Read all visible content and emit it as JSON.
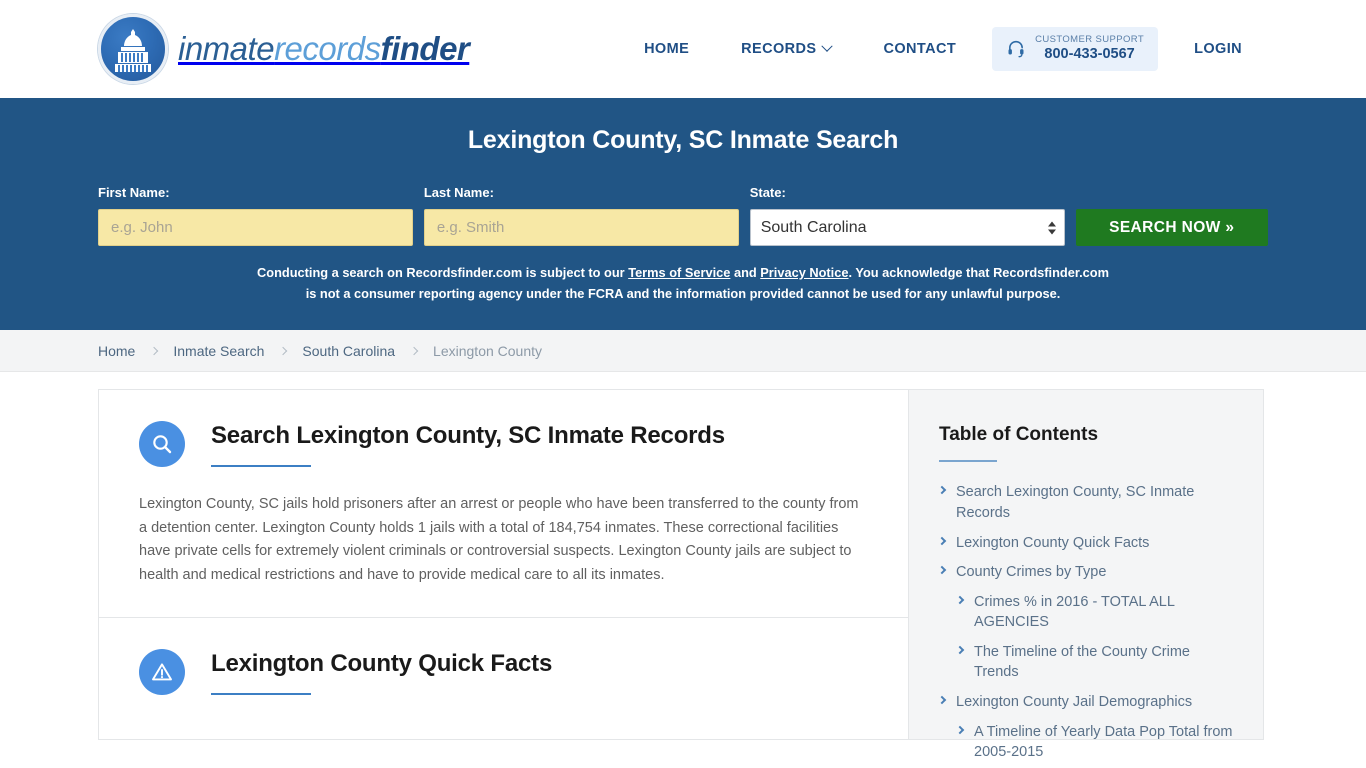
{
  "header": {
    "logo": {
      "icon": "capitol-dome-icon",
      "part1": "inmate",
      "part2": "records",
      "part3": "finder"
    },
    "nav": [
      {
        "label": "HOME",
        "has_caret": false
      },
      {
        "label": "RECORDS",
        "has_caret": true
      },
      {
        "label": "CONTACT",
        "has_caret": false
      }
    ],
    "support": {
      "icon": "headset-icon",
      "label": "CUSTOMER SUPPORT",
      "phone": "800-433-0567"
    },
    "login_label": "LOGIN"
  },
  "hero": {
    "title": "Lexington County, SC Inmate Search",
    "first_name": {
      "label": "First Name:",
      "value": "",
      "placeholder": "e.g. John"
    },
    "last_name": {
      "label": "Last Name:",
      "value": "",
      "placeholder": "e.g. Smith"
    },
    "state": {
      "label": "State:",
      "value": "South Carolina"
    },
    "search_button": "SEARCH NOW »",
    "disclaimer": {
      "part1": "Conducting a search on Recordsfinder.com is subject to our ",
      "link1": "Terms of Service",
      "part2": " and ",
      "link2": "Privacy Notice",
      "part3": ". You acknowledge that Recordsfinder.com is not a consumer reporting agency under the FCRA and the information provided cannot be used for any unlawful purpose."
    },
    "bg_color": "#215585",
    "button_color": "#1f7a20",
    "input_color": "#f7e8a6"
  },
  "breadcrumb": [
    {
      "label": "Home",
      "current": false
    },
    {
      "label": "Inmate Search",
      "current": false
    },
    {
      "label": "South Carolina",
      "current": false
    },
    {
      "label": "Lexington County",
      "current": true
    }
  ],
  "main": {
    "sections": [
      {
        "icon": "magnifier-icon",
        "title": "Search Lexington County, SC Inmate Records",
        "text": "Lexington County, SC jails hold prisoners after an arrest or people who have been transferred to the county from a detention center. Lexington County holds 1 jails with a total of 184,754 inmates. These correctional facilities have private cells for extremely violent criminals or controversial suspects. Lexington County jails are subject to health and medical restrictions and have to provide medical care to all its inmates."
      },
      {
        "icon": "warning-icon",
        "title": "Lexington County Quick Facts",
        "text": ""
      }
    ]
  },
  "sidebar": {
    "title": "Table of Contents",
    "items": [
      {
        "label": "Search Lexington County, SC Inmate Records",
        "level": 1
      },
      {
        "label": "Lexington County Quick Facts",
        "level": 1
      },
      {
        "label": "County Crimes by Type",
        "level": 1
      },
      {
        "label": "Crimes % in 2016 - TOTAL ALL AGENCIES",
        "level": 2
      },
      {
        "label": "The Timeline of the County Crime Trends",
        "level": 2
      },
      {
        "label": "Lexington County Jail Demographics",
        "level": 1
      },
      {
        "label": "A Timeline of Yearly Data Pop Total from 2005-2015",
        "level": 2
      }
    ]
  }
}
